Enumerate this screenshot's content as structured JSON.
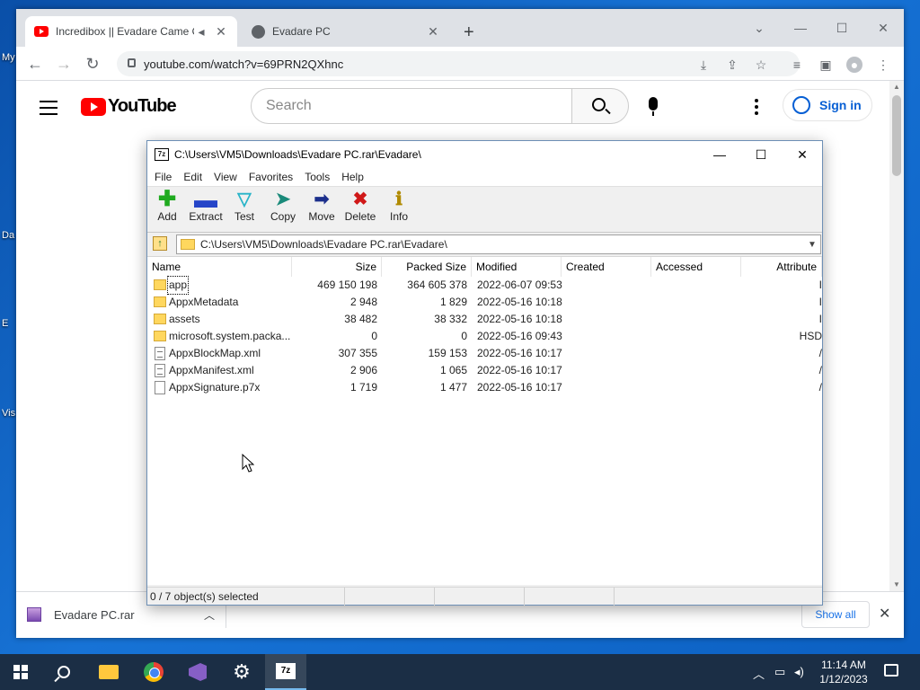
{
  "desktop": {
    "labels": [
      "My",
      "Da",
      "E",
      "Vis"
    ]
  },
  "browser": {
    "tabs": [
      {
        "title": "Incredibox || Evadare Came O",
        "favicon": "youtube-icon",
        "close": "✕"
      },
      {
        "title": "Evadare PC",
        "favicon": "globe-icon",
        "close": "✕"
      }
    ],
    "new_tab": "+",
    "url": "youtube.com/watch?v=69PRN2QXhnc"
  },
  "youtube": {
    "logo_text": "YouTube",
    "search_placeholder": "Search",
    "sign_in": "Sign in",
    "accent_color": "#ff0000"
  },
  "sevenzip": {
    "title": "C:\\Users\\VM5\\Downloads\\Evadare PC.rar\\Evadare\\",
    "logo": "7z",
    "menu": [
      "File",
      "Edit",
      "View",
      "Favorites",
      "Tools",
      "Help"
    ],
    "tools": [
      {
        "label": "Add",
        "icon": "add-icon"
      },
      {
        "label": "Extract",
        "icon": "extract-icon"
      },
      {
        "label": "Test",
        "icon": "test-icon"
      },
      {
        "label": "Copy",
        "icon": "copy-icon"
      },
      {
        "label": "Move",
        "icon": "move-icon"
      },
      {
        "label": "Delete",
        "icon": "delete-icon"
      },
      {
        "label": "Info",
        "icon": "info-icon"
      }
    ],
    "address": "C:\\Users\\VM5\\Downloads\\Evadare PC.rar\\Evadare\\",
    "columns": [
      "Name",
      "Size",
      "Packed Size",
      "Modified",
      "Created",
      "Accessed",
      "Attribute"
    ],
    "files": [
      {
        "name": "app",
        "size": "469 150 198",
        "packed": "364 605 378",
        "modified": "2022-06-07 09:53",
        "created": "",
        "accessed": "",
        "attr": "I",
        "type": "folder"
      },
      {
        "name": "AppxMetadata",
        "size": "2 948",
        "packed": "1 829",
        "modified": "2022-05-16 10:18",
        "created": "",
        "accessed": "",
        "attr": "I",
        "type": "folder"
      },
      {
        "name": "assets",
        "size": "38 482",
        "packed": "38 332",
        "modified": "2022-05-16 10:18",
        "created": "",
        "accessed": "",
        "attr": "I",
        "type": "folder"
      },
      {
        "name": "microsoft.system.packa...",
        "size": "0",
        "packed": "0",
        "modified": "2022-05-16 09:43",
        "created": "",
        "accessed": "",
        "attr": "HSD",
        "type": "folder"
      },
      {
        "name": "AppxBlockMap.xml",
        "size": "307 355",
        "packed": "159 153",
        "modified": "2022-05-16 10:17",
        "created": "",
        "accessed": "",
        "attr": "/",
        "type": "xml"
      },
      {
        "name": "AppxManifest.xml",
        "size": "2 906",
        "packed": "1 065",
        "modified": "2022-05-16 10:17",
        "created": "",
        "accessed": "",
        "attr": "/",
        "type": "xml"
      },
      {
        "name": "AppxSignature.p7x",
        "size": "1 719",
        "packed": "1 477",
        "modified": "2022-05-16 10:17",
        "created": "",
        "accessed": "",
        "attr": "/",
        "type": "file"
      }
    ],
    "status": "0 / 7 object(s) selected"
  },
  "downloads": {
    "file": "Evadare PC.rar",
    "show_all": "Show all"
  },
  "taskbar": {
    "time": "11:14 AM",
    "date": "1/12/2023"
  }
}
